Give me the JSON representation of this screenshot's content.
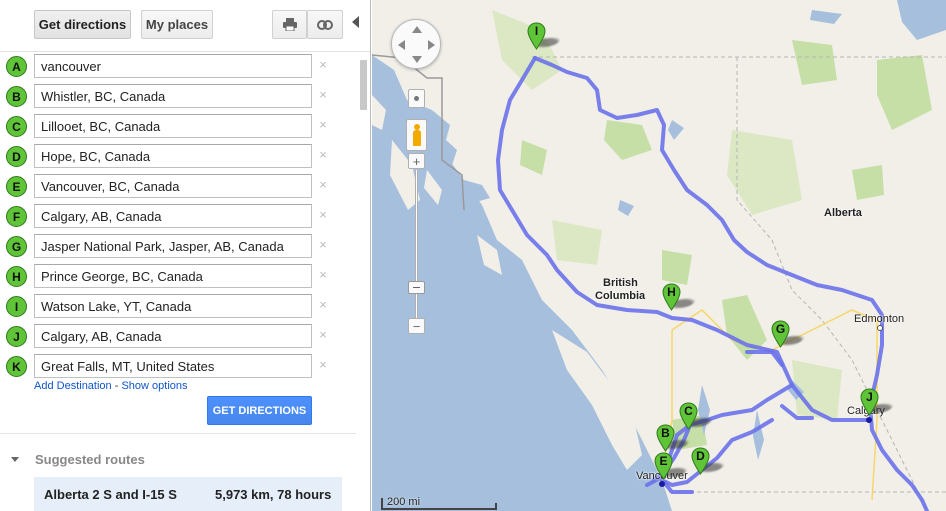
{
  "toolbar": {
    "get_directions_label": "Get directions",
    "my_places_label": "My places",
    "print_icon": "print-icon",
    "link_icon": "link-icon",
    "collapse_icon": "collapse-panel-icon"
  },
  "waypoints": [
    {
      "letter": "A",
      "value": "vancouver"
    },
    {
      "letter": "B",
      "value": "Whistler, BC, Canada"
    },
    {
      "letter": "C",
      "value": "Lillooet, BC, Canada"
    },
    {
      "letter": "D",
      "value": "Hope, BC, Canada"
    },
    {
      "letter": "E",
      "value": "Vancouver, BC, Canada"
    },
    {
      "letter": "F",
      "value": "Calgary, AB, Canada"
    },
    {
      "letter": "G",
      "value": "Jasper National Park, Jasper, AB, Canada"
    },
    {
      "letter": "H",
      "value": "Prince George, BC, Canada"
    },
    {
      "letter": "I",
      "value": "Watson Lake, YT, Canada"
    },
    {
      "letter": "J",
      "value": "Calgary, AB, Canada"
    },
    {
      "letter": "K",
      "value": "Great Falls, MT, United States"
    }
  ],
  "remove_glyph": "×",
  "actions": {
    "add_destination": "Add Destination",
    "separator": " - ",
    "show_options": "Show options",
    "get_directions_button": "GET DIRECTIONS"
  },
  "suggested": {
    "title": "Suggested routes",
    "routes": [
      {
        "name": "Alberta 2 S and I-15 S",
        "info": "5,973 km, 78 hours"
      }
    ]
  },
  "map": {
    "labels": {
      "alberta": "Alberta",
      "british_columbia_1": "British",
      "british_columbia_2": "Columbia",
      "edmonton": "Edmonton",
      "calgary": "Calgary",
      "vancouver": "Vancouver"
    },
    "pins": [
      "I",
      "H",
      "G",
      "J",
      "C",
      "B",
      "D",
      "E"
    ],
    "scale": "200 mi",
    "colors": {
      "route": "#6a72ea",
      "pin": "#5fc438",
      "water": "#a5bfdd",
      "land": "#f2efe9",
      "park": "#c5dfa6",
      "forest": "#dce8c4"
    },
    "zoom_in": "+",
    "zoom_out": "−"
  }
}
